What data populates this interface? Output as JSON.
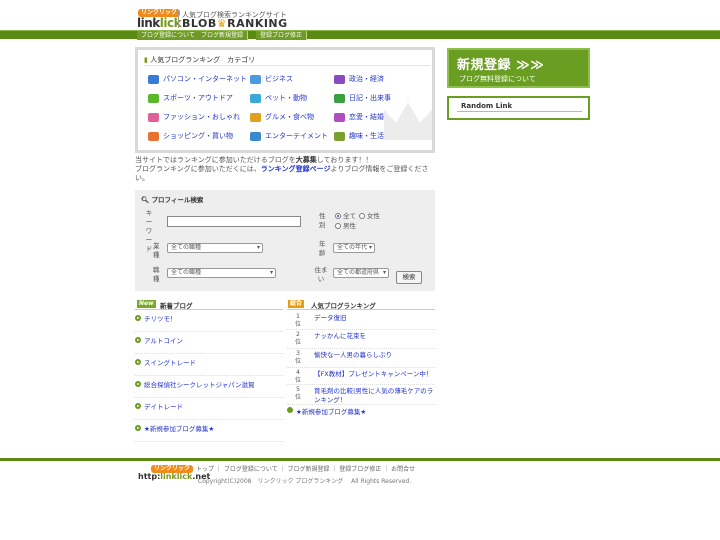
{
  "header": {
    "logo_small": "リンクリック",
    "logo_main_a": "link",
    "logo_main_b": "lick",
    "tagline": "人気ブログ検索ランキングサイト",
    "brand_a": "BLOB",
    "brand_crown": "♛",
    "brand_b": "RANKING"
  },
  "nav": {
    "items": [
      "ブログ登録について",
      "ブログ新規登録",
      "登録ブログ修正"
    ]
  },
  "categories": {
    "title_prefix": "人気ブログランキング",
    "title_suffix": "カテゴリ",
    "items": [
      {
        "label": "パソコン・インターネット",
        "color": "#3a7bd5"
      },
      {
        "label": "ビジネス",
        "color": "#4a9be0"
      },
      {
        "label": "政治・経済",
        "color": "#8a4ac0"
      },
      {
        "label": "スポーツ・アウトドア",
        "color": "#5ab82a"
      },
      {
        "label": "ペット・動物",
        "color": "#3aa8d8"
      },
      {
        "label": "日記・出来事",
        "color": "#3aa040"
      },
      {
        "label": "ファッション・おしゃれ",
        "color": "#e0609a"
      },
      {
        "label": "グルメ・食べ物",
        "color": "#e0a020"
      },
      {
        "label": "恋愛・結婚",
        "color": "#b050c0"
      },
      {
        "label": "ショッピング・買い物",
        "color": "#e87030"
      },
      {
        "label": "エンターテイメント",
        "color": "#3a8ad0"
      },
      {
        "label": "趣味・生活",
        "color": "#7aa030"
      }
    ]
  },
  "intro": {
    "line1_a": "当サイトではランキングに参加いただけるブログを",
    "line1_b": "大募集",
    "line1_c": "しております！！",
    "line2_a": "ブログランキングに参加いただくには、",
    "line2_link": "ランキング登録ページ",
    "line2_b": "よりブログ情報をご登録くださ",
    "line3": "い。"
  },
  "search": {
    "title": "プロフィール検索",
    "keyword_label": "キーワード",
    "gender_label": "性別",
    "gender_options": [
      "全て",
      "女性",
      "男性"
    ],
    "occupation_label": "業種",
    "occupation_value": "全ての職種",
    "age_label": "年齢",
    "age_value": "全ての年代",
    "job_label": "職種",
    "job_value": "全ての職種",
    "residence_label": "住まい",
    "residence_value": "全ての都道府県",
    "button": "検索"
  },
  "new_blogs": {
    "badge": "New",
    "title": "新着ブログ",
    "items": [
      "チリツモ！",
      "アルトコイン",
      "スイングトレード",
      "総合探偵社シークレットジャパン滋賀",
      "デイトレード",
      "★新規参加ブログ募集★"
    ]
  },
  "ranking": {
    "badge": "総合",
    "title": "人気ブログランキング",
    "rank_suffix": "位",
    "items": [
      {
        "rank": "1",
        "label": "データ復旧"
      },
      {
        "rank": "2",
        "label": "ナッかんに花束を"
      },
      {
        "rank": "3",
        "label": "愉快な一人男の暮らしぶり"
      },
      {
        "rank": "4",
        "label": "【FX教材】プレゼントキャンペーン中！"
      },
      {
        "rank": "5",
        "label": "育毛剤の比較|男性に人気の薄毛ケアのランキング！"
      }
    ],
    "recruit": "★新規参加ブログ募集★"
  },
  "sidebar": {
    "signup_big": "新規登録 ≫≫",
    "signup_small": "ブログ無料登録について",
    "random_title": "Random Link"
  },
  "footer": {
    "logo_small": "リンクリック",
    "logo_a": "http:",
    "logo_b": "linklick",
    "logo_c": ".net",
    "links": "トップ ｜ ブログ登録について ｜ ブログ新規登録 ｜ 登録ブログ修正 ｜ お問合せ",
    "copyright": "Copyright(C)2008　リンクリック ブログランキング　 All Rights Reserved."
  }
}
